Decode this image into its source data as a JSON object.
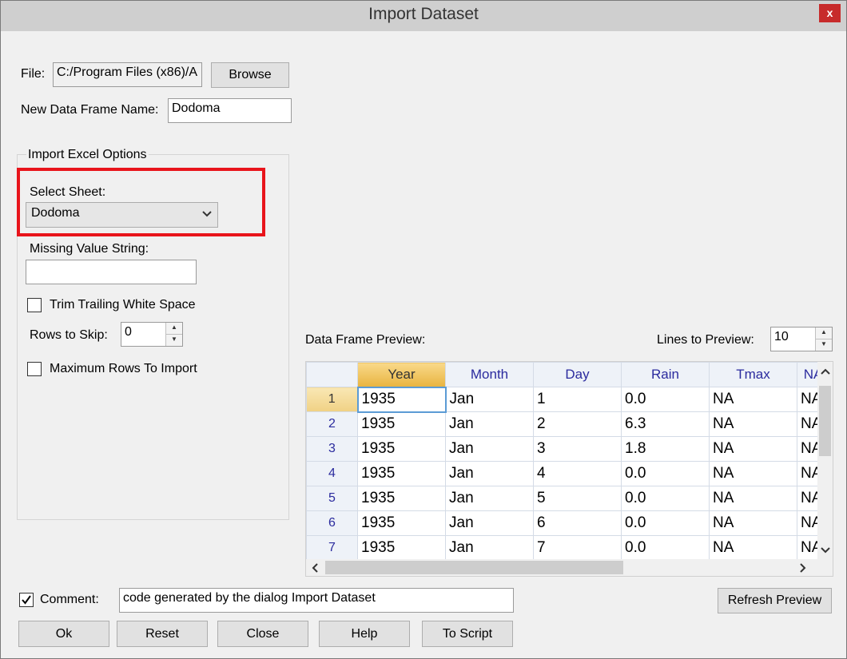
{
  "window": {
    "title": "Import Dataset",
    "close_label": "x"
  },
  "file": {
    "label": "File:",
    "value": "C:/Program Files (x86)/A",
    "browse_label": "Browse"
  },
  "frame_name": {
    "label": "New Data Frame Name:",
    "value": "Dodoma"
  },
  "excel_options": {
    "title": "Import Excel Options",
    "sheet_label": "Select Sheet:",
    "sheet_value": "Dodoma",
    "missing_label": "Missing Value String:",
    "missing_value": "",
    "trim_label": "Trim Trailing White Space",
    "trim_checked": false,
    "skip_label": "Rows to Skip:",
    "skip_value": "0",
    "maxrows_label": "Maximum Rows To Import",
    "maxrows_checked": false
  },
  "preview": {
    "label": "Data Frame Preview:",
    "lines_label": "Lines to Preview:",
    "lines_value": "10",
    "columns": [
      "Year",
      "Month",
      "Day",
      "Rain",
      "Tmax",
      "NA"
    ],
    "rows": [
      {
        "n": "1",
        "cells": [
          "1935",
          "Jan",
          "1",
          "0.0",
          "NA",
          "NA"
        ]
      },
      {
        "n": "2",
        "cells": [
          "1935",
          "Jan",
          "2",
          "6.3",
          "NA",
          "NA"
        ]
      },
      {
        "n": "3",
        "cells": [
          "1935",
          "Jan",
          "3",
          "1.8",
          "NA",
          "NA"
        ]
      },
      {
        "n": "4",
        "cells": [
          "1935",
          "Jan",
          "4",
          "0.0",
          "NA",
          "NA"
        ]
      },
      {
        "n": "5",
        "cells": [
          "1935",
          "Jan",
          "5",
          "0.0",
          "NA",
          "NA"
        ]
      },
      {
        "n": "6",
        "cells": [
          "1935",
          "Jan",
          "6",
          "0.0",
          "NA",
          "NA"
        ]
      },
      {
        "n": "7",
        "cells": [
          "1935",
          "Jan",
          "7",
          "0.0",
          "NA",
          "NA"
        ]
      }
    ]
  },
  "comment": {
    "label": "Comment:",
    "checked": true,
    "value": "code generated by the dialog Import Dataset"
  },
  "buttons": {
    "refresh": "Refresh Preview",
    "ok": "Ok",
    "reset": "Reset",
    "close": "Close",
    "help": "Help",
    "to_script": "To Script"
  },
  "highlight_color": "#e8141b"
}
